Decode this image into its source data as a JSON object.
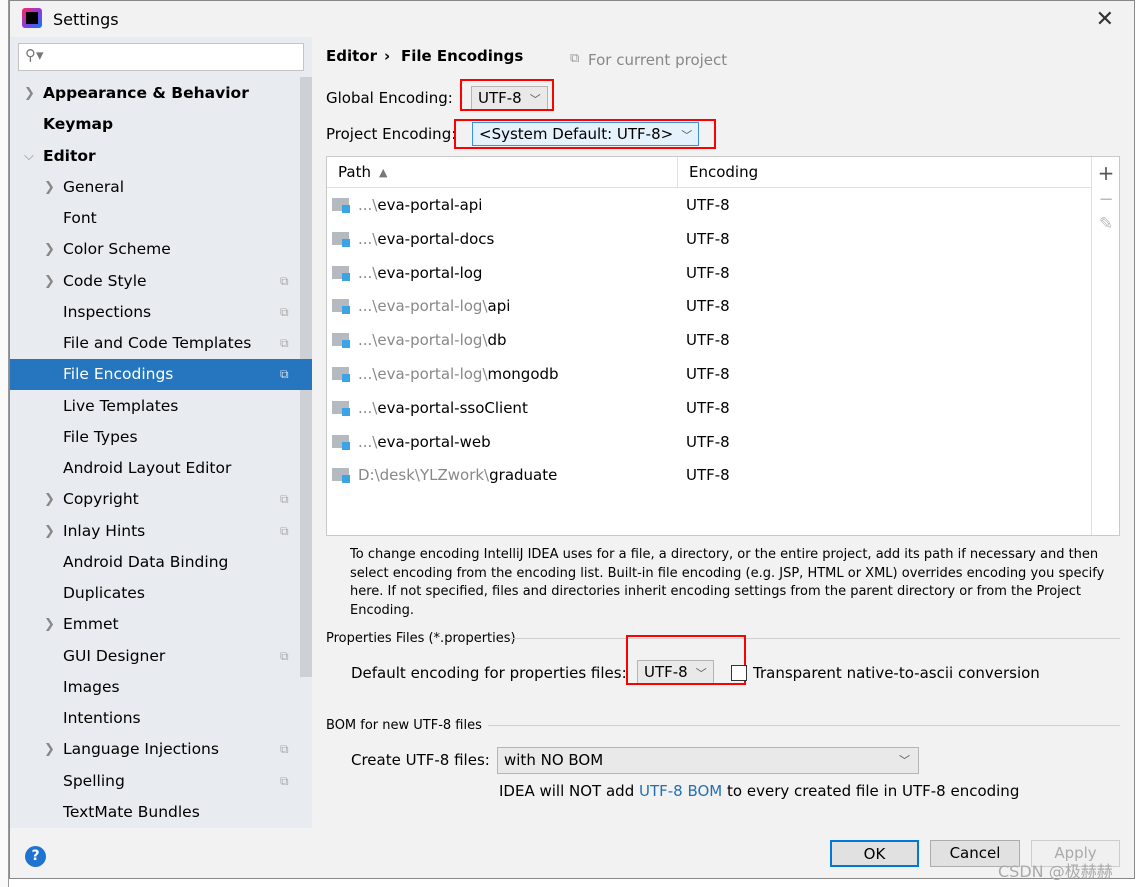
{
  "window": {
    "title": "Settings"
  },
  "sidebar": {
    "search_placeholder": "",
    "items": [
      {
        "label": "Appearance & Behavior",
        "bold": true,
        "arrow": "right",
        "level": 0
      },
      {
        "label": "Keymap",
        "bold": true,
        "level": 0
      },
      {
        "label": "Editor",
        "bold": true,
        "arrow": "down",
        "level": 0
      },
      {
        "label": "General",
        "arrow": "right",
        "level": 1
      },
      {
        "label": "Font",
        "level": 1
      },
      {
        "label": "Color Scheme",
        "arrow": "right",
        "level": 1
      },
      {
        "label": "Code Style",
        "arrow": "right",
        "level": 1,
        "copy": true
      },
      {
        "label": "Inspections",
        "level": 1,
        "copy": true
      },
      {
        "label": "File and Code Templates",
        "level": 1,
        "copy": true
      },
      {
        "label": "File Encodings",
        "level": 1,
        "copy": true,
        "selected": true
      },
      {
        "label": "Live Templates",
        "level": 1
      },
      {
        "label": "File Types",
        "level": 1
      },
      {
        "label": "Android Layout Editor",
        "level": 1
      },
      {
        "label": "Copyright",
        "arrow": "right",
        "level": 1,
        "copy": true
      },
      {
        "label": "Inlay Hints",
        "arrow": "right",
        "level": 1,
        "copy": true
      },
      {
        "label": "Android Data Binding",
        "level": 1
      },
      {
        "label": "Duplicates",
        "level": 1
      },
      {
        "label": "Emmet",
        "arrow": "right",
        "level": 1
      },
      {
        "label": "GUI Designer",
        "level": 1,
        "copy": true
      },
      {
        "label": "Images",
        "level": 1
      },
      {
        "label": "Intentions",
        "level": 1
      },
      {
        "label": "Language Injections",
        "arrow": "right",
        "level": 1,
        "copy": true
      },
      {
        "label": "Spelling",
        "level": 1,
        "copy": true
      },
      {
        "label": "TextMate Bundles",
        "level": 1
      }
    ]
  },
  "breadcrumb": {
    "parent": "Editor",
    "separator": "›",
    "current": "File Encodings",
    "scope": "For current project"
  },
  "global_encoding": {
    "label": "Global Encoding:",
    "value": "UTF-8"
  },
  "project_encoding": {
    "label": "Project Encoding:",
    "value": "<System Default: UTF-8>"
  },
  "table": {
    "columns": [
      "Path",
      "Encoding"
    ],
    "sort": "ascending",
    "rows": [
      {
        "prefix": "...\\",
        "name": "eva-portal-api",
        "encoding": "UTF-8"
      },
      {
        "prefix": "...\\",
        "name": "eva-portal-docs",
        "encoding": "UTF-8"
      },
      {
        "prefix": "...\\",
        "name": "eva-portal-log",
        "encoding": "UTF-8"
      },
      {
        "prefix": "...\\eva-portal-log\\",
        "name": "api",
        "encoding": "UTF-8"
      },
      {
        "prefix": "...\\eva-portal-log\\",
        "name": "db",
        "encoding": "UTF-8"
      },
      {
        "prefix": "...\\eva-portal-log\\",
        "name": "mongodb",
        "encoding": "UTF-8"
      },
      {
        "prefix": "...\\",
        "name": "eva-portal-ssoClient",
        "encoding": "UTF-8"
      },
      {
        "prefix": "...\\",
        "name": "eva-portal-web",
        "encoding": "UTF-8"
      },
      {
        "prefix": "D:\\desk\\YLZwork\\",
        "name": "graduate",
        "encoding": "UTF-8"
      }
    ],
    "tools": {
      "add": "+",
      "remove": "−",
      "edit": "✎"
    }
  },
  "description": "To change encoding IntelliJ IDEA uses for a file, a directory, or the entire project, add its path if necessary and then select encoding from the encoding list. Built-in file encoding (e.g. JSP, HTML or XML) overrides encoding you specify here. If not specified, files and directories inherit encoding settings from the parent directory or from the Project Encoding.",
  "properties": {
    "section": "Properties Files (*.properties)",
    "label": "Default encoding for properties files:",
    "value": "UTF-8",
    "checkbox_label": "Transparent native-to-ascii conversion",
    "checked": false
  },
  "bom": {
    "section": "BOM for new UTF-8 files",
    "label": "Create UTF-8 files:",
    "value": "with NO BOM",
    "note_pre": "IDEA will NOT add ",
    "note_link": "UTF-8 BOM",
    "note_post": " to every created file in UTF-8 encoding"
  },
  "buttons": {
    "ok": "OK",
    "cancel": "Cancel",
    "apply": "Apply",
    "help": "?"
  },
  "watermark": "CSDN @极赫赫",
  "colors": {
    "selection": "#2675bf",
    "annotation": "#ff0000",
    "link": "#2470b3"
  }
}
